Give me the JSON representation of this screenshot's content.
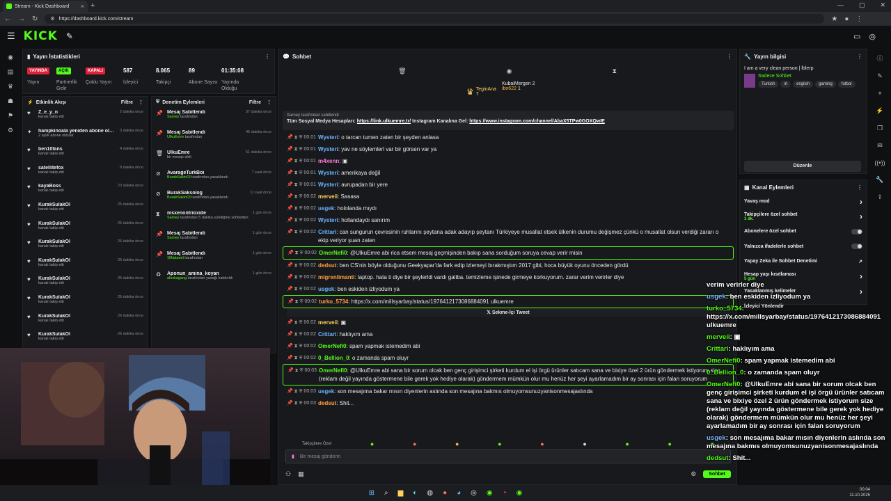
{
  "browser": {
    "tab_title": "Stream - Kick Dashboard",
    "url": "https://dashboard.kick.com/stream"
  },
  "brand": {
    "logo": "KICK",
    "accent": "#53fc18"
  },
  "stats": {
    "title": "Yayın İstatistikleri",
    "items": [
      {
        "badge": "YAYINDA",
        "label": "Yayın",
        "color": "#e0213a"
      },
      {
        "badge": "AÇIK",
        "label": "Partnerlik Gelir",
        "color": "#53fc18"
      },
      {
        "badge": "KAPALI",
        "label": "Çoklu Yayın",
        "color": "#e0213a"
      },
      {
        "value": "587",
        "label": "İzleyici"
      },
      {
        "value": "8.065",
        "label": "Takipçi"
      },
      {
        "value": "89",
        "label": "Abone Sayısı"
      },
      {
        "value": "01:35:08",
        "label": "Yayında Olduğu"
      }
    ]
  },
  "activity": {
    "title": "Etkinlik Akışı",
    "filter": "Filtre",
    "items": [
      {
        "name": "Z_e_y_n",
        "desc": "kanalı takip etti",
        "time": "2 dakika önce"
      },
      {
        "name": "hampkinoala yeniden abone oldu!",
        "desc": "2 aylık abone oldular",
        "time": "3 dakika önce"
      },
      {
        "name": "ben10fans",
        "desc": "kanalı takip etti",
        "time": "4 dakika önce"
      },
      {
        "name": "satellitefox",
        "desc": "kanalı takip etti",
        "time": "8 dakika önce"
      },
      {
        "name": "kayaBoss",
        "desc": "kanalı takip etti",
        "time": "23 dakika önce"
      },
      {
        "name": "KurakSulakOl",
        "desc": "kanalı takip etti",
        "time": "25 dakika önce"
      },
      {
        "name": "KurakSulakOl",
        "desc": "kanalı takip etti",
        "time": "26 dakika önce"
      },
      {
        "name": "KurakSulakOl",
        "desc": "kanalı takip etti",
        "time": "26 dakika önce"
      },
      {
        "name": "KurakSulakOl",
        "desc": "kanalı takip etti",
        "time": "26 dakika önce"
      },
      {
        "name": "KurakSulakOl",
        "desc": "kanalı takip etti",
        "time": "26 dakika önce"
      },
      {
        "name": "KurakSulakOl",
        "desc": "kanalı takip etti",
        "time": "26 dakika önce"
      },
      {
        "name": "KurakSulakOl",
        "desc": "kanalı takip etti",
        "time": "26 dakika önce"
      },
      {
        "name": "KurakSulakOl",
        "desc": "kanalı takip etti",
        "time": "26 dakika önce"
      }
    ]
  },
  "modlog": {
    "title": "Denetim Eylemleri",
    "filter": "Filtre",
    "items": [
      {
        "name": "Mesaj Sabitlendi",
        "actor": "Sarney",
        "desc": "tarafından",
        "time": "37 dakika önce"
      },
      {
        "name": "Mesaj Sabitlendi",
        "actor": "UlkuEmre",
        "desc": "tarafından",
        "time": "45 dakika önce"
      },
      {
        "name": "UlkuEmre",
        "actor": "",
        "desc": "bir mesajı sildi",
        "time": "51 dakika önce"
      },
      {
        "name": "AvarageTurkBoi",
        "actor": "BurakSakinOl",
        "desc": "tarafından yasaklandı",
        "time": "7 saat önce"
      },
      {
        "name": "BurakSaksolog",
        "actor": "BurakSakinOl",
        "desc": "tarafından yasaklandı",
        "time": "11 saat önce"
      },
      {
        "name": "msxenontrioxide",
        "actor": "Sarney",
        "desc": "tarafından 5 dakika süreliğine sohbetten uzaklaştırıldı",
        "time": "1 gün önce"
      },
      {
        "name": "Mesaj Sabitlendi",
        "actor": "Sarney",
        "desc": "tarafından",
        "time": "1 gün önce"
      },
      {
        "name": "Mesaj Sabitlendi",
        "actor": "1Makaveli",
        "desc": "tarafından",
        "time": "1 gün önce"
      },
      {
        "name": "Aponun_amina_koyan",
        "actor": "aloskagang",
        "desc": "tarafından yasağı kaldırıldı",
        "time": "1 gün önce"
      }
    ]
  },
  "chat": {
    "title": "Sohbet",
    "top_gifters": [
      {
        "name": "TeginAna",
        "count": "7"
      },
      {
        "name": "KubaiMergen",
        "count": "2"
      },
      {
        "name": "ibo622",
        "count": "1"
      }
    ],
    "pinned_by": "Sarney tarafından sabitlendi",
    "pinned_text": "Tüm Sosyal Medya Hesapları:",
    "pinned_link1": "https://link.ulkuemre.tr/",
    "pinned_mid": "Instagram Kanalına Gel:",
    "pinned_link2": "https://www.instagram.com/channel/AbaX5TPw0GOXQwIE",
    "messages": [
      {
        "time": "00:01",
        "user": "Wysteri",
        "color": "blue",
        "text": "o tarcan tumen zaten bir şeyden anlasa"
      },
      {
        "time": "00:01",
        "user": "Wysteri",
        "color": "blue",
        "text": "yav ne söylemlerl var bir görsen var ya"
      },
      {
        "time": "00:01",
        "user": "m4xenn",
        "color": "pink",
        "text": "▣"
      },
      {
        "time": "00:01",
        "user": "Wysteri",
        "color": "blue",
        "text": "amerikaya değil"
      },
      {
        "time": "00:01",
        "user": "Wysteri",
        "color": "blue",
        "text": "avrupadan bir yere"
      },
      {
        "time": "00:02",
        "user": "merveii",
        "color": "yellow",
        "text": "Sasasa"
      },
      {
        "time": "00:02",
        "user": "usgek",
        "color": "blue",
        "text": "hololanda mıydı"
      },
      {
        "time": "00:02",
        "user": "Wysteri",
        "color": "blue",
        "text": "hollandaydı sanırım"
      },
      {
        "time": "00:02",
        "user": "Crittari",
        "color": "blue",
        "text": "can sungurun çevresinin ruhlarını şeytana adak adayıp şeytanı Türkiyeye musallat etsek ülkenin durumu değişmez çünkü o musallat olsun verdiği zararı o ekip veriyor şuan zaten"
      },
      {
        "time": "00:02",
        "user": "OmerNefi0",
        "color": "green",
        "text": "@UlkuEmre abi rica etsem mesaj geçmişinden bakıp sana sorduğum soruya cevap verir misin",
        "hl": true
      },
      {
        "time": "00:02",
        "user": "dedsut",
        "color": "orange",
        "text": "ben CS'nin böyle olduğunu Geekyapar'da fark edip izlemeyi bırakmıştım 2017 gibi, hoca büyük oyunu önceden gördü"
      },
      {
        "time": "00:02",
        "user": "migrenlimanti",
        "color": "orange",
        "text": "laptop. hata ti diye bir şeylerldi vardı galiba. temizleme işinede girmeye korkuyorum. zarar verim verirler diye"
      },
      {
        "time": "00:02",
        "user": "usgek",
        "color": "blue",
        "text": "ben eskiden izliyodum ya"
      },
      {
        "time": "00:02",
        "user": "turko_5734",
        "color": "orange",
        "text": "https://x.com/millsyarbay/status/1976412173086884091 ulkuemre",
        "hl": true
      },
      {
        "time": "00:02",
        "user": "merveii",
        "color": "yellow",
        "text": "▣"
      },
      {
        "time": "00:02",
        "user": "Crittari",
        "color": "blue",
        "text": "haklıyım ama"
      },
      {
        "time": "00:02",
        "user": "OmerNefi0",
        "color": "green",
        "text": "spam yapmak istemedim abi"
      },
      {
        "time": "00:02",
        "user": "0_Bellion_0",
        "color": "green",
        "text": "o zamanda spam oluyr"
      },
      {
        "time": "00:03",
        "user": "OmerNefi0",
        "color": "green",
        "text": "@UlkuEmre abi sana bir sorum olcak ben genç girişimci şirketi kurdum el işi örgü ürünler satıcam sana ve bixiye özel 2 ürün göndermek istiyorum size (reklam değil yayında göstermene bile gerek yok hediye olarak) göndermem mümkün olur mu henüz her şeyi ayarlamadım bir ay sonrası için falan soruyorum",
        "hl": true
      },
      {
        "time": "00:03",
        "user": "usgek",
        "color": "blue",
        "text": "son mesajıma bakar mısın diyenlerin aslında son mesajına bakmıs olmuyomsunuzyanisonmesajaslında"
      },
      {
        "time": "00:03",
        "user": "dedsut",
        "color": "orange",
        "text": "Shit..."
      }
    ],
    "embed_label": "Sekme-İçi Tweet",
    "emote_label": "Takipçilere Özel",
    "input_placeholder": "Bir mesaj gönderin",
    "send_label": "Sohbet"
  },
  "info": {
    "title": "Yayın bilgisi",
    "stream_title": "I am a very clean person | lblerp",
    "category": "Sadece Sohbet",
    "tags": [
      "Turkish",
      "irl",
      "english",
      "gaming",
      "futbol"
    ],
    "edit": "Düzenle"
  },
  "actions": {
    "title": "Kanal Eylemleri",
    "items": [
      {
        "label": "Yavaş mod",
        "type": "arrow",
        "sub": ""
      },
      {
        "label": "Takipçilere özel sohbet",
        "type": "arrow",
        "sub": "1 dk."
      },
      {
        "label": "Abonelere özel sohbet",
        "type": "toggle",
        "sub": ""
      },
      {
        "label": "Yalnızca ifadelerle sohbet",
        "type": "toggle",
        "sub": ""
      },
      {
        "label": "Yapay Zeka ile Sohbet Denetimi",
        "type": "ext",
        "sub": ""
      },
      {
        "label": "Hesap yaşı kısıtlaması",
        "type": "arrow",
        "sub": "5 gün"
      },
      {
        "label": "Yasaklanmış kelimeler",
        "type": "arrow",
        "sub": ""
      },
      {
        "label": "İzleyici Yönlendir",
        "type": "none",
        "sub": ""
      }
    ]
  },
  "overlay": [
    {
      "u": "",
      "t": "verim verirler diye"
    },
    {
      "u": "usgek",
      "t": ": ben eskiden izliyodum ya"
    },
    {
      "u": "turko_5734",
      "t": ": https://x.com/millsyarbay/status/1976412173086884091 ulkuemre"
    },
    {
      "u": "merveii",
      "t": ": ▣"
    },
    {
      "u": "Crittari",
      "t": ": haklıyım ama"
    },
    {
      "u": "OmerNefi0",
      "t": ": spam yapmak istemedim abi"
    },
    {
      "u": "0_Bellion_0",
      "t": ": o zamanda spam oluyr"
    },
    {
      "u": "OmerNefi0",
      "t": ": @UlkuEmre abi sana bir sorum olcak ben genç girişimci şirketi kurdum el işi örgü ürünler satıcam sana ve bixiye özel 2 ürün göndermek istiyorum size (reklam değil yayında göstermene bile gerek yok hediye olarak) göndermem mümkün olur mu henüz her şeyi ayarlamadım bir ay sonrası için falan soruyorum"
    },
    {
      "u": "usgek",
      "t": ": son mesajıma bakar mısın diyenlerin aslında son mesajına bakmıs olmuyomsunuzyanisonmesajaslında"
    },
    {
      "u": "dedsut",
      "t": ": Shit..."
    }
  ],
  "clock": {
    "time": "00:04",
    "date": "11.10.2025"
  }
}
